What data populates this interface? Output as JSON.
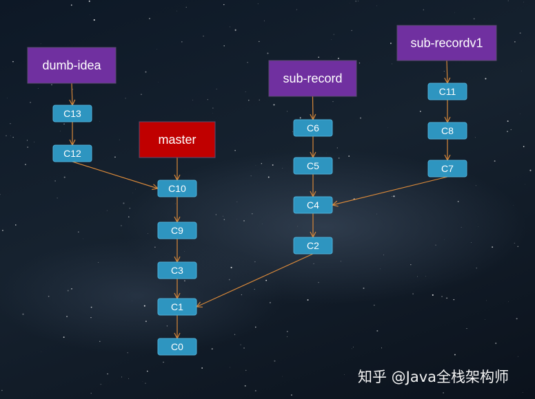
{
  "colors": {
    "branch_purple": "#7030a0",
    "branch_red": "#c00000",
    "commit": "#2e95c0",
    "arrow": "#d9893a"
  },
  "branches": [
    {
      "id": "dumb-idea",
      "label": "dumb-idea",
      "color": "#7030a0"
    },
    {
      "id": "master",
      "label": "master",
      "color": "#c00000"
    },
    {
      "id": "sub-record",
      "label": "sub-record",
      "color": "#7030a0"
    },
    {
      "id": "sub-recordv1",
      "label": "sub-recordv1",
      "color": "#7030a0"
    }
  ],
  "commits": [
    "C13",
    "C12",
    "C10",
    "C9",
    "C3",
    "C1",
    "C0",
    "C6",
    "C5",
    "C4",
    "C2",
    "C11",
    "C8",
    "C7"
  ],
  "edges": [
    [
      "dumb-idea",
      "C13"
    ],
    [
      "C13",
      "C12"
    ],
    [
      "C12",
      "C10"
    ],
    [
      "master",
      "C10"
    ],
    [
      "C10",
      "C9"
    ],
    [
      "C9",
      "C3"
    ],
    [
      "C3",
      "C1"
    ],
    [
      "C1",
      "C0"
    ],
    [
      "sub-record",
      "C6"
    ],
    [
      "C6",
      "C5"
    ],
    [
      "C5",
      "C4"
    ],
    [
      "C4",
      "C2"
    ],
    [
      "C2",
      "C1"
    ],
    [
      "sub-recordv1",
      "C11"
    ],
    [
      "C11",
      "C8"
    ],
    [
      "C8",
      "C7"
    ],
    [
      "C7",
      "C4"
    ]
  ],
  "watermark": "知乎 @Java全栈架构师"
}
